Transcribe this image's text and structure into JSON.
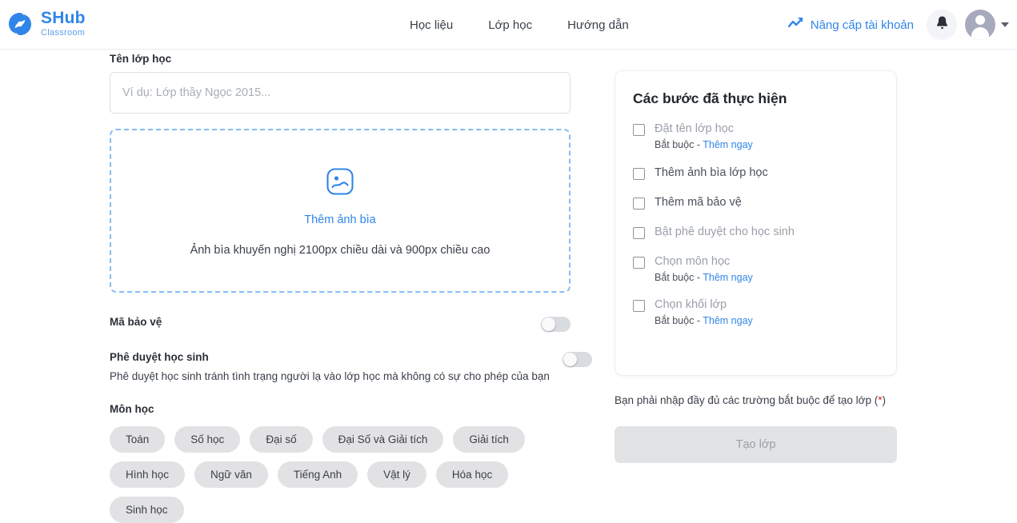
{
  "header": {
    "brand": {
      "name": "SHub",
      "tagline": "Classroom",
      "logo_icon": "shub-logo-icon"
    },
    "nav": [
      {
        "label": "Học liệu"
      },
      {
        "label": "Lớp học"
      },
      {
        "label": "Hướng dẫn"
      }
    ],
    "upgrade": {
      "label": "Nâng cấp tài khoản",
      "icon": "trending-up-icon",
      "color": "#2f86e8"
    },
    "bell_icon": "bell-icon",
    "avatar_icon": "user-avatar-icon",
    "caret_icon": "chevron-down-icon"
  },
  "form": {
    "class_name": {
      "label": "Tên lớp học",
      "value": "",
      "placeholder": "Ví dụ: Lớp thầy Ngọc 2015..."
    },
    "cover": {
      "icon": "image-placeholder-icon",
      "link_label": "Thêm ảnh bìa",
      "hint": "Ảnh bìa khuyến nghị 2100px chiều dài và 900px chiều cao"
    },
    "protect_code": {
      "label": "Mã bảo vệ",
      "enabled": false
    },
    "approve_student": {
      "label": "Phê duyệt học sinh",
      "description": "Phê duyệt học sinh tránh tình trạng người lạ vào lớp học mà không có sự cho phép của bạn",
      "enabled": false
    },
    "subject": {
      "label": "Môn học",
      "options": [
        "Toán",
        "Số học",
        "Đại số",
        "Đại Số và Giải tích",
        "Giải tích",
        "Hình học",
        "Ngữ văn",
        "Tiếng Anh",
        "Vật lý",
        "Hóa học",
        "Sinh học"
      ]
    }
  },
  "steps_panel": {
    "title": "Các bước đã thực hiện",
    "required_prefix": "Bắt buộc - ",
    "action_link": "Thêm ngay",
    "items": [
      {
        "name": "Đặt tên lớp học",
        "checked": false,
        "required": true,
        "dim": true
      },
      {
        "name": "Thêm ảnh bìa lớp học",
        "checked": false,
        "required": false,
        "dim": false
      },
      {
        "name": "Thêm mã bảo vệ",
        "checked": false,
        "required": false,
        "dim": false
      },
      {
        "name": "Bật phê duyệt cho học sinh",
        "checked": false,
        "required": false,
        "dim": true
      },
      {
        "name": "Chọn môn học",
        "checked": false,
        "required": true,
        "dim": true
      },
      {
        "name": "Chọn khối lớp",
        "checked": false,
        "required": true,
        "dim": true
      }
    ],
    "note_text": "Bạn phải nhập đầy đủ các trường bắt buộc để tạo lớp (",
    "note_star": "*",
    "note_close": ")",
    "create_button": "Tạo lớp"
  }
}
